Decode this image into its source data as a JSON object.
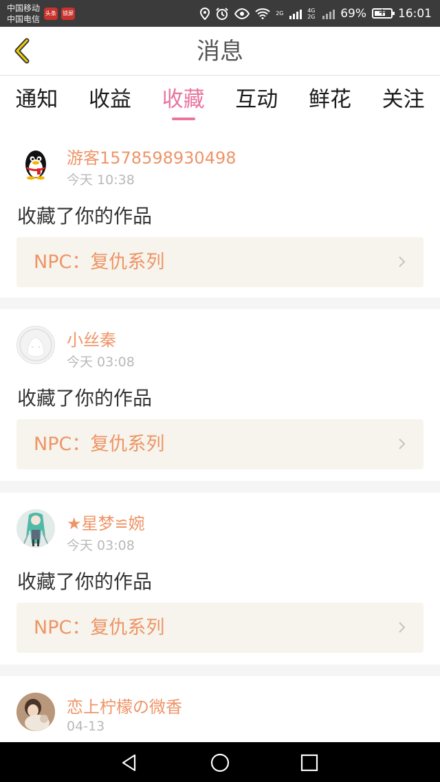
{
  "status_bar": {
    "carrier_1": "中国移动",
    "carrier_2": "中国电信",
    "app_icon_1": "头条",
    "app_icon_2": "锁屏",
    "network_1": "2G",
    "network_2": "4G",
    "network_3": "2G",
    "battery_percent": "69%",
    "battery_level": 0.69,
    "time": "16:01",
    "icons": [
      "location-icon",
      "alarm-icon",
      "eye-icon",
      "wifi-icon",
      "signal-icon",
      "battery-icon"
    ]
  },
  "header": {
    "title": "消息",
    "back_icon": "chevron-left-icon"
  },
  "tabs": [
    {
      "label": "通知",
      "active": false
    },
    {
      "label": "收益",
      "active": false
    },
    {
      "label": "收藏",
      "active": true
    },
    {
      "label": "互动",
      "active": false
    },
    {
      "label": "鲜花",
      "active": false
    },
    {
      "label": "关注",
      "active": false
    }
  ],
  "messages": [
    {
      "username": "游客1578598930498",
      "time": "今天 10:38",
      "action": "收藏了你的作品",
      "work": "NPC：复仇系列",
      "avatar": "qq-penguin-avatar"
    },
    {
      "username": "小丝秦",
      "time": "今天 03:08",
      "action": "收藏了你的作品",
      "work": "NPC：复仇系列",
      "avatar": "default-avatar"
    },
    {
      "username": "★星梦≌婉",
      "time": "今天 03:08",
      "action": "收藏了你的作品",
      "work": "NPC：复仇系列",
      "avatar": "anime-avatar"
    },
    {
      "username": "恋上柠檬の微香",
      "time": "04-13",
      "avatar": "photo-avatar"
    }
  ],
  "nav_bar": {
    "icons": [
      "back-triangle-icon",
      "home-circle-icon",
      "recents-square-icon"
    ]
  },
  "colors": {
    "accent_pink": "#e9759f",
    "username_orange": "#ee9466",
    "status_bar": "#3b3b3b",
    "work_box_bg": "#f6f4ec"
  }
}
